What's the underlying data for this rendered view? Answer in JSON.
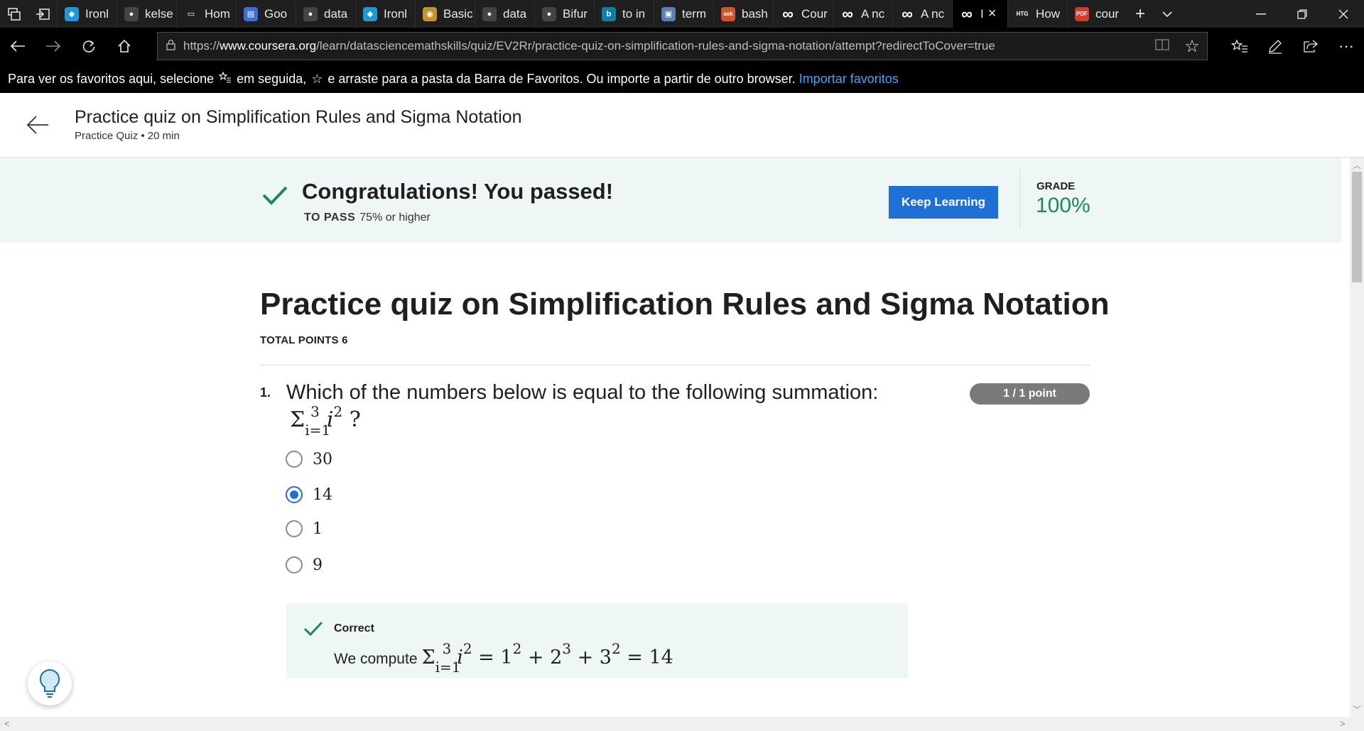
{
  "browser": {
    "tabs": [
      {
        "label": "Ironl",
        "icon": "ironhack-icon",
        "color": "#1a9bd7"
      },
      {
        "label": "kelse",
        "icon": "github-icon",
        "color": "#444444"
      },
      {
        "label": "Hom",
        "icon": "window-icon",
        "color": "#1f1f1f"
      },
      {
        "label": "Goo",
        "icon": "google-docs-icon",
        "color": "#3b6fd9"
      },
      {
        "label": "data",
        "icon": "github-icon",
        "color": "#444444"
      },
      {
        "label": "Ironl",
        "icon": "ironhack-icon",
        "color": "#1a9bd7"
      },
      {
        "label": "Basic",
        "icon": "basic-icon",
        "color": "#c4942b"
      },
      {
        "label": "data",
        "icon": "github-icon",
        "color": "#444444"
      },
      {
        "label": "Bifur",
        "icon": "github-icon",
        "color": "#444444"
      },
      {
        "label": "to in",
        "icon": "bing-icon",
        "color": "#0f7ea8"
      },
      {
        "label": "term",
        "icon": "terminal-icon",
        "color": "#5c7fb3"
      },
      {
        "label": "bash",
        "icon": "ask-icon",
        "color": "#d2542c"
      },
      {
        "label": "Cour",
        "icon": "infinity-icon",
        "color": "#1f1f1f"
      },
      {
        "label": "A nc",
        "icon": "infinity-icon",
        "color": "#1f1f1f"
      },
      {
        "label": "A nc",
        "icon": "infinity-icon",
        "color": "#1f1f1f"
      },
      {
        "label": "I",
        "icon": "infinity-icon",
        "color": "#000000",
        "active": true
      },
      {
        "label": "How",
        "icon": "htg-icon",
        "color": "#222222"
      },
      {
        "label": "cour",
        "icon": "pdf-icon",
        "color": "#d23c2c"
      }
    ],
    "url_prefix": "https://",
    "url_domain": "www.coursera.org",
    "url_path": "/learn/datasciencemathskills/quiz/EV2Rr/practice-quiz-on-simplification-rules-and-sigma-notation/attempt?redirectToCover=true",
    "favbar_text_1": "Para ver os favoritos aqui, selecione",
    "favbar_text_2": "em seguida,",
    "favbar_text_3": "e arraste para a pasta da Barra de Favoritos. Ou importe a partir de outro browser.",
    "favbar_link": "Importar favoritos"
  },
  "header": {
    "title": "Practice quiz on Simplification Rules and Sigma Notation",
    "subtitle": "Practice Quiz • 20 min"
  },
  "banner": {
    "title": "Congratulations! You passed!",
    "to_pass_label": "TO PASS",
    "to_pass_value": "75% or higher",
    "button": "Keep Learning",
    "grade_label": "GRADE",
    "grade_value": "100%",
    "accent": "#1d8a5a"
  },
  "quiz": {
    "title": "Practice quiz on Simplification Rules and Sigma Notation",
    "total_points": "TOTAL POINTS 6",
    "question": {
      "number": "1.",
      "text": "Which of the numbers below is equal to the following summation:",
      "points": "1 / 1 point",
      "options": [
        {
          "label": "30",
          "selected": false
        },
        {
          "label": "14",
          "selected": true
        },
        {
          "label": "1",
          "selected": false
        },
        {
          "label": "9",
          "selected": false
        }
      ],
      "feedback": {
        "status": "Correct",
        "text": "We compute"
      }
    }
  }
}
